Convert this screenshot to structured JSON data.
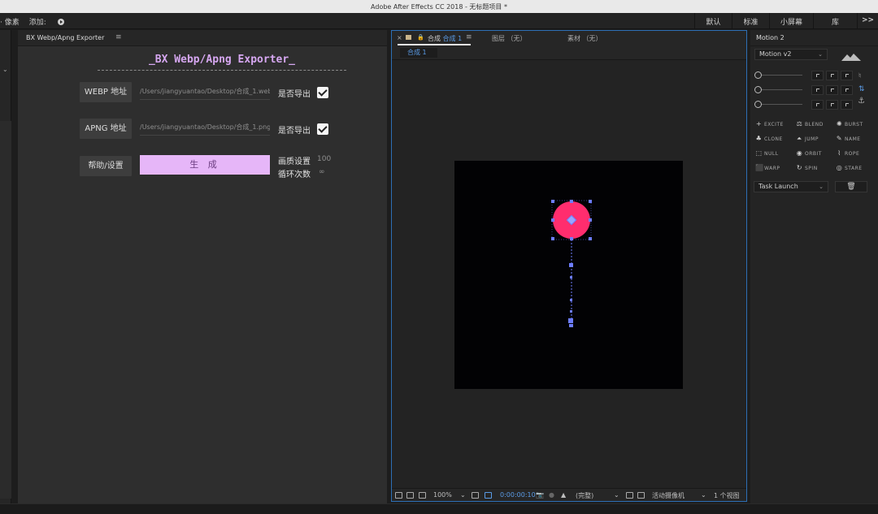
{
  "window": {
    "title": "Adobe After Effects CC 2018 - 无标题项目 *"
  },
  "menubar": {
    "pixels_label": "· 像素",
    "add_label": "添加:",
    "workspaces": [
      "默认",
      "标准",
      "小屏幕",
      "库"
    ],
    "more": ">>"
  },
  "exporter": {
    "tab_label": "BX Webp/Apng Exporter",
    "tab_menu": "≡",
    "title": "_BX Webp/Apng Exporter_",
    "webp_button": "WEBP 地址",
    "webp_path": "/Users/jiangyuantao/Desktop/合成_1.webp",
    "apng_button": "APNG 地址",
    "apng_path": "/Users/jiangyuantao/Desktop/合成_1.png",
    "export_flag": "是否导出",
    "help_button": "帮助/设置",
    "generate_button": "生 成",
    "quality_label": "画质设置",
    "quality_value": "100",
    "loop_label": "循环次数",
    "loop_value": "∞"
  },
  "viewer": {
    "close": "×",
    "comp_tab_prefix": "合成",
    "comp_tab_name": "合成 1",
    "tab_menu": "≡",
    "layer_tab": "图层 （无）",
    "footage_tab": "素材 （无）",
    "comp_chip": "合成 1",
    "zoom": "100%",
    "timecode": "0:00:00:10",
    "resolution": "(完整)",
    "camera": "活动摄像机",
    "views": "1 个视图",
    "colors": {
      "ball": "#ff2d6e",
      "handles": "#6d7dff",
      "accent": "#5a9be6"
    }
  },
  "motion": {
    "tab_label": "Motion 2",
    "version_select": "Motion v2",
    "functions": [
      {
        "icon": "+",
        "label": "EXCITE"
      },
      {
        "icon": "⚖",
        "label": "BLEND"
      },
      {
        "icon": "✺",
        "label": "BURST"
      },
      {
        "icon": "♣",
        "label": "CLONE"
      },
      {
        "icon": "⏶",
        "label": "JUMP"
      },
      {
        "icon": "✎",
        "label": "NAME"
      },
      {
        "icon": "⬚",
        "label": "NULL"
      },
      {
        "icon": "◉",
        "label": "ORBIT"
      },
      {
        "icon": "⌇",
        "label": "ROPE"
      },
      {
        "icon": "⬛",
        "label": "WARP"
      },
      {
        "icon": "↻",
        "label": "SPIN"
      },
      {
        "icon": "◎",
        "label": "STARE"
      }
    ],
    "task_select": "Task Launch",
    "trash": "🗑"
  }
}
